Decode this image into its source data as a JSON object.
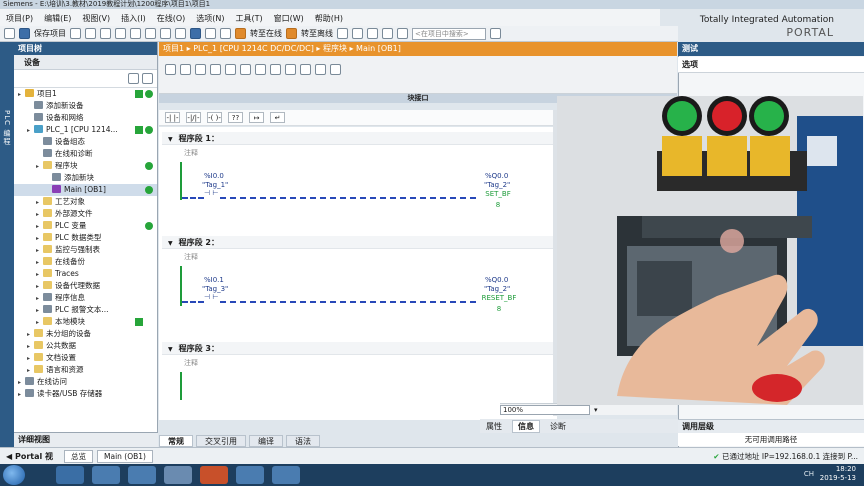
{
  "titlebar": {
    "text": "Siemens - E:\\培训\\3.教材\\2019教程计划\\1200程序\\项目1\\项目1"
  },
  "menu": [
    "项目(P)",
    "编辑(E)",
    "视图(V)",
    "插入(I)",
    "在线(O)",
    "选项(N)",
    "工具(T)",
    "窗口(W)",
    "帮助(H)"
  ],
  "toolbar": {
    "save_label": "保存项目",
    "go_online": "转至在线",
    "go_offline": "转至离线",
    "search_placeholder": "<在项目中搜索>"
  },
  "brand": {
    "line1": "Totally Integrated Automation",
    "line2": "PORTAL"
  },
  "vertical_tab": "PLC 编程",
  "project_tree": {
    "title": "项目树",
    "section": "设备",
    "items": [
      {
        "label": "项目1",
        "level": 0,
        "icon": "project-icon",
        "check": true,
        "dot": true
      },
      {
        "label": "添加新设备",
        "level": 1,
        "icon": "add-device-icon"
      },
      {
        "label": "设备和网络",
        "level": 1,
        "icon": "network-icon"
      },
      {
        "label": "PLC_1 [CPU 1214...",
        "level": 1,
        "icon": "plc-icon",
        "check": true,
        "dot": true
      },
      {
        "label": "设备组态",
        "level": 2,
        "icon": "config-icon"
      },
      {
        "label": "在线和诊断",
        "level": 2,
        "icon": "diagnostics-icon"
      },
      {
        "label": "程序块",
        "level": 2,
        "icon": "folder-icon",
        "dot": true
      },
      {
        "label": "添加新块",
        "level": 3,
        "icon": "add-block-icon"
      },
      {
        "label": "Main [OB1]",
        "level": 3,
        "icon": "ob-icon",
        "dot": true,
        "selected": true
      },
      {
        "label": "工艺对象",
        "level": 2,
        "icon": "folder-icon"
      },
      {
        "label": "外部源文件",
        "level": 2,
        "icon": "folder-icon"
      },
      {
        "label": "PLC 变量",
        "level": 2,
        "icon": "folder-icon",
        "dot": true
      },
      {
        "label": "PLC 数据类型",
        "level": 2,
        "icon": "folder-icon"
      },
      {
        "label": "监控与强制表",
        "level": 2,
        "icon": "folder-icon"
      },
      {
        "label": "在线备份",
        "level": 2,
        "icon": "folder-icon"
      },
      {
        "label": "Traces",
        "level": 2,
        "icon": "folder-icon"
      },
      {
        "label": "设备代理数据",
        "level": 2,
        "icon": "folder-icon"
      },
      {
        "label": "程序信息",
        "level": 2,
        "icon": "info-icon"
      },
      {
        "label": "PLC 报警文本...",
        "level": 2,
        "icon": "text-icon"
      },
      {
        "label": "本地模块",
        "level": 2,
        "icon": "folder-icon",
        "check": true
      },
      {
        "label": "未分组的设备",
        "level": 1,
        "icon": "folder-icon"
      },
      {
        "label": "公共数据",
        "level": 1,
        "icon": "folder-icon"
      },
      {
        "label": "文档设置",
        "level": 1,
        "icon": "folder-icon"
      },
      {
        "label": "语言和资源",
        "level": 1,
        "icon": "folder-icon"
      },
      {
        "label": "在线访问",
        "level": 0,
        "icon": "online-icon"
      },
      {
        "label": "读卡器/USB 存储器",
        "level": 0,
        "icon": "usb-icon"
      }
    ],
    "detail_view": "详细视图"
  },
  "editor": {
    "breadcrumb": "项目1 ▸ PLC_1 [CPU 1214C DC/DC/DC] ▸ 程序块 ▸ Main [OB1]",
    "block_interface": "块接口",
    "networks": [
      {
        "title": "程序段 1：",
        "comment": "注释",
        "contact_addr": "%I0.0",
        "contact_tag": "\"Tag_1\"",
        "coil_addr": "%Q0.0",
        "coil_tag": "\"Tag_2\"",
        "coil_op": "SET_BF",
        "coil_count": "8"
      },
      {
        "title": "程序段 2：",
        "comment": "注释",
        "contact_addr": "%I0.1",
        "contact_tag": "\"Tag_3\"",
        "coil_addr": "%Q0.0",
        "coil_tag": "\"Tag_2\"",
        "coil_op": "RESET_BF",
        "coil_count": "8"
      },
      {
        "title": "程序段 3：",
        "comment": "注释"
      }
    ],
    "zoom": "100%"
  },
  "inspector_tabs": [
    "属性",
    "信息",
    "诊断"
  ],
  "inspector_active": "信息",
  "bottom_tabs": [
    "常规",
    "交叉引用",
    "编译",
    "语法"
  ],
  "right_panel": {
    "title": "测试",
    "options": "选项",
    "call_hierarchy": "调用层级",
    "no_call_path": "无可用调用路径"
  },
  "portal_bar": {
    "portal_view": "Portal 视图",
    "tabs": [
      "总览",
      "Main (OB1)"
    ],
    "connection": "已通过地址 IP=192.168.0.1 连接到 P..."
  },
  "taskbar": {
    "time": "18:20",
    "date": "2019-5-13",
    "lang": "CH"
  },
  "colors": {
    "accent_orange": "#e8932c",
    "panel_blue": "#2d5b86",
    "status_green": "#27a53a",
    "ladder_blue": "#2848b8"
  }
}
